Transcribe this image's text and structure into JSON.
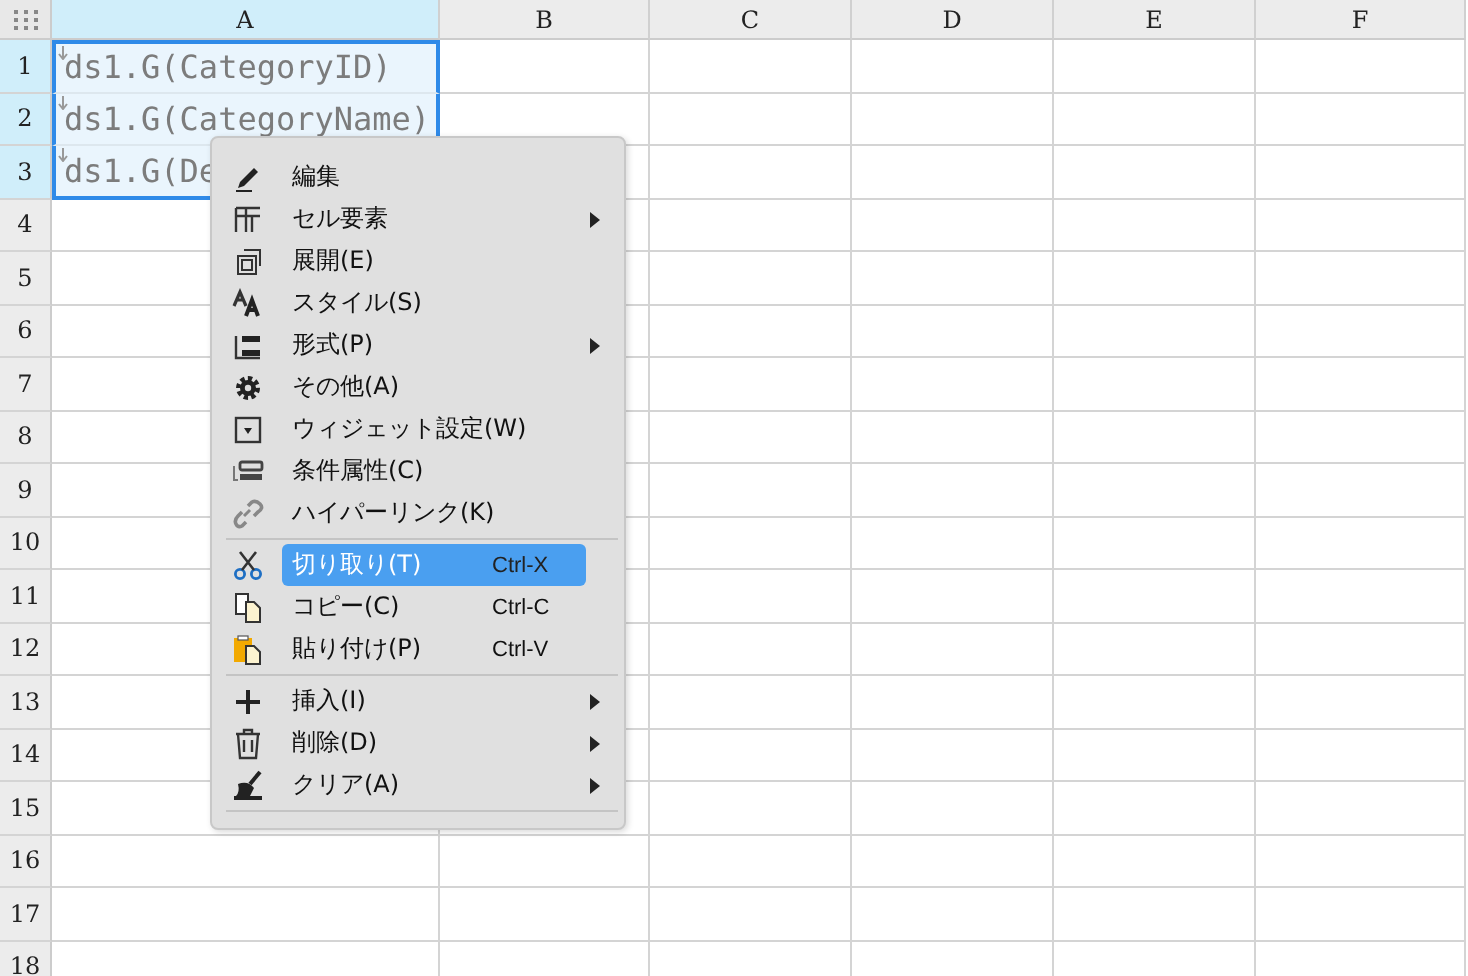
{
  "columns": [
    {
      "label": "A",
      "selected": true
    },
    {
      "label": "B",
      "selected": false
    },
    {
      "label": "C",
      "selected": false
    },
    {
      "label": "D",
      "selected": false
    },
    {
      "label": "E",
      "selected": false
    },
    {
      "label": "F",
      "selected": false
    }
  ],
  "rows": [
    {
      "label": "1",
      "selected": true,
      "cells": [
        "ds1.G(CategoryID)"
      ]
    },
    {
      "label": "2",
      "selected": true,
      "cells": [
        "ds1.G(CategoryName)"
      ]
    },
    {
      "label": "3",
      "selected": true,
      "cells": [
        "ds1.G(De"
      ]
    },
    {
      "label": "4",
      "selected": false,
      "cells": []
    },
    {
      "label": "5",
      "selected": false,
      "cells": []
    },
    {
      "label": "6",
      "selected": false,
      "cells": []
    },
    {
      "label": "7",
      "selected": false,
      "cells": []
    },
    {
      "label": "8",
      "selected": false,
      "cells": []
    },
    {
      "label": "9",
      "selected": false,
      "cells": []
    },
    {
      "label": "10",
      "selected": false,
      "cells": []
    },
    {
      "label": "11",
      "selected": false,
      "cells": []
    },
    {
      "label": "12",
      "selected": false,
      "cells": []
    },
    {
      "label": "13",
      "selected": false,
      "cells": []
    },
    {
      "label": "14",
      "selected": false,
      "cells": []
    },
    {
      "label": "15",
      "selected": false,
      "cells": []
    },
    {
      "label": "16",
      "selected": false,
      "cells": []
    },
    {
      "label": "17",
      "selected": false,
      "cells": []
    },
    {
      "label": "18",
      "selected": false,
      "cells": []
    }
  ],
  "context_menu": [
    {
      "kind": "item",
      "label": "編集",
      "selected": false,
      "submenu": false
    },
    {
      "kind": "item",
      "label": "セル要素",
      "selected": false,
      "submenu": true
    },
    {
      "kind": "item",
      "label": "展開(E)",
      "selected": false,
      "submenu": false
    },
    {
      "kind": "item",
      "label": "スタイル(S)",
      "selected": false,
      "submenu": false
    },
    {
      "kind": "item",
      "label": "形式(P)",
      "selected": false,
      "submenu": true
    },
    {
      "kind": "item",
      "label": "その他(A)",
      "selected": false,
      "submenu": false
    },
    {
      "kind": "item",
      "label": "ウィジェット設定(W)",
      "selected": false,
      "submenu": false
    },
    {
      "kind": "item",
      "label": "条件属性(C)",
      "selected": false,
      "submenu": false
    },
    {
      "kind": "item",
      "label": "ハイパーリンク(K)",
      "selected": false,
      "submenu": false
    },
    {
      "kind": "separator"
    },
    {
      "kind": "item",
      "label": "切り取り(T)",
      "shortcut": "Ctrl-X",
      "selected": true,
      "submenu": false
    },
    {
      "kind": "item",
      "label": "コピー(C)",
      "shortcut": "Ctrl-C",
      "selected": false,
      "submenu": false
    },
    {
      "kind": "item",
      "label": "貼り付け(P)",
      "shortcut": "Ctrl-V",
      "selected": false,
      "submenu": false
    },
    {
      "kind": "separator"
    },
    {
      "kind": "item",
      "label": "挿入(I)",
      "selected": false,
      "submenu": true
    },
    {
      "kind": "item",
      "label": "削除(D)",
      "selected": false,
      "submenu": true
    },
    {
      "kind": "item",
      "label": "クリア(A)",
      "selected": false,
      "submenu": true
    },
    {
      "kind": "separator"
    }
  ]
}
